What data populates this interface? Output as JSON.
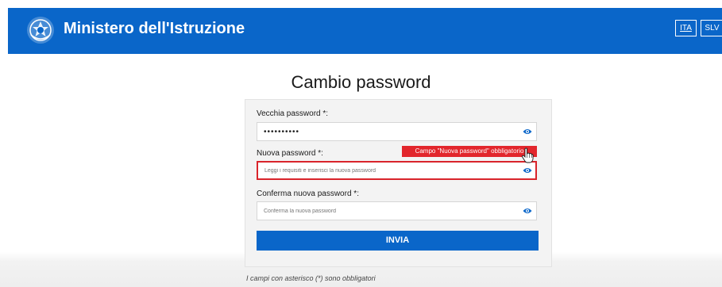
{
  "header": {
    "logo_icon": "emblem-icon",
    "title": "Ministero dell'Istruzione",
    "languages": [
      "ITA",
      "SLV"
    ],
    "active_language": "ITA",
    "color": "#0a66c9"
  },
  "page": {
    "title": "Cambio password"
  },
  "form": {
    "old_password": {
      "label": "Vecchia password",
      "required_mark": "*:",
      "value": "••••••••••",
      "icon": "eye-icon"
    },
    "new_password": {
      "label": "Nuova password",
      "required_mark": "*:",
      "placeholder": "Leggi i requisiti e inserisci la nuova password",
      "error": "Campo \"Nuova password\" obbligatorio",
      "icon": "eye-icon"
    },
    "confirm_password": {
      "label": "Conferma nuova password",
      "required_mark": "*:",
      "placeholder": "Conferma la nuova password",
      "icon": "eye-icon"
    },
    "submit_label": "INVIA"
  },
  "footnote": "I campi con asterisco (*) sono obbligatori",
  "colors": {
    "primary": "#0a66c9",
    "error": "#e2262c"
  }
}
